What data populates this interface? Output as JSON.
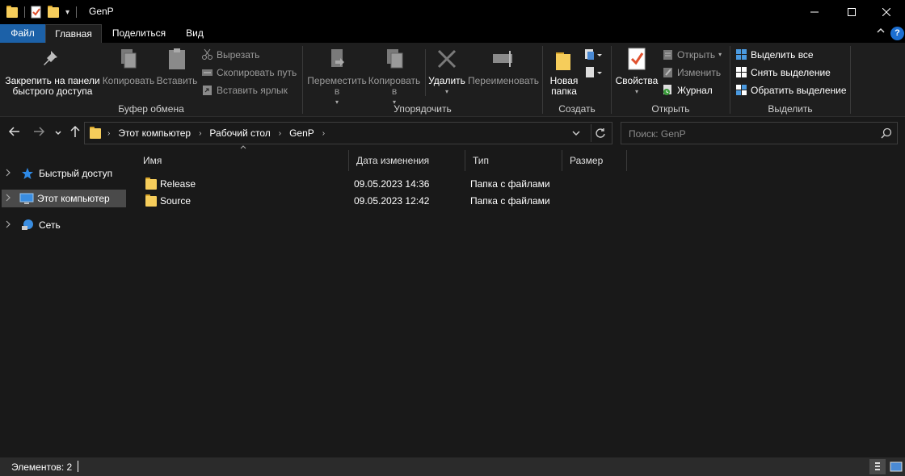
{
  "window": {
    "title": "GenP",
    "minimize": "—",
    "maximize": "☐",
    "close": "✕"
  },
  "ribbon_tabs": {
    "file": "Файл",
    "home": "Главная",
    "share": "Поделиться",
    "view": "Вид",
    "collapse": "^",
    "help": "?"
  },
  "clipboard": {
    "pin": "Закрепить на панели быстрого доступа",
    "copy": "Копировать",
    "paste": "Вставить",
    "cut": "Вырезать",
    "copy_path": "Скопировать путь",
    "paste_shortcut": "Вставить ярлык",
    "label": "Буфер обмена"
  },
  "organize": {
    "move_to": "Переместить в",
    "copy_to": "Копировать в",
    "delete": "Удалить",
    "rename": "Переименовать",
    "label": "Упорядочить"
  },
  "new": {
    "new_folder": "Новая папка",
    "label": "Создать"
  },
  "open": {
    "properties": "Свойства",
    "open": "Открыть",
    "edit": "Изменить",
    "history": "Журнал",
    "label": "Открыть"
  },
  "select": {
    "select_all": "Выделить все",
    "select_none": "Снять выделение",
    "invert": "Обратить выделение",
    "label": "Выделить"
  },
  "address": {
    "crumbs": [
      "Этот компьютер",
      "Рабочий стол",
      "GenP"
    ]
  },
  "search": {
    "placeholder": "Поиск: GenP"
  },
  "nav_pane": {
    "items": [
      "Быстрый доступ",
      "Этот компьютер",
      "Сеть"
    ]
  },
  "columns": {
    "name": "Имя",
    "date": "Дата изменения",
    "type": "Тип",
    "size": "Размер"
  },
  "files": [
    {
      "name": "Release",
      "date": "09.05.2023 14:36",
      "type": "Папка с файлами",
      "size": ""
    },
    {
      "name": "Source",
      "date": "09.05.2023 12:42",
      "type": "Папка с файлами",
      "size": ""
    }
  ],
  "status": {
    "items_count": "Элементов: 2"
  },
  "colors": {
    "accent": "#1c61a8",
    "background": "#191919",
    "folder": "#f6cd5b"
  }
}
